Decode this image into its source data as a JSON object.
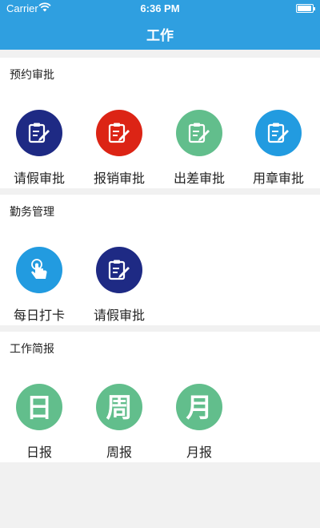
{
  "status_bar": {
    "carrier": "Carrier",
    "time": "6:36 PM",
    "battery_level": 0.95
  },
  "nav": {
    "title": "工作"
  },
  "sections": [
    {
      "title": "预约审批",
      "items": [
        {
          "label": "请假审批",
          "color": "#1e2a84",
          "icon": "edit-document-icon"
        },
        {
          "label": "报销审批",
          "color": "#dc2415",
          "icon": "edit-document-icon"
        },
        {
          "label": "出差审批",
          "color": "#62be8c",
          "icon": "edit-document-icon"
        },
        {
          "label": "用章审批",
          "color": "#229be0",
          "icon": "edit-document-icon"
        }
      ]
    },
    {
      "title": "勤务管理",
      "items": [
        {
          "label": "每日打卡",
          "color": "#229be0",
          "icon": "tap-hand-icon"
        },
        {
          "label": "请假审批",
          "color": "#1e2a84",
          "icon": "edit-document-icon"
        }
      ]
    },
    {
      "title": "工作简报",
      "items": [
        {
          "label": "日报",
          "color": "#62be8c",
          "icon": "daily-report-icon",
          "glyph": "日"
        },
        {
          "label": "周报",
          "color": "#62be8c",
          "icon": "weekly-report-icon",
          "glyph": "周"
        },
        {
          "label": "月报",
          "color": "#62be8c",
          "icon": "monthly-report-icon",
          "glyph": "月"
        }
      ]
    }
  ]
}
